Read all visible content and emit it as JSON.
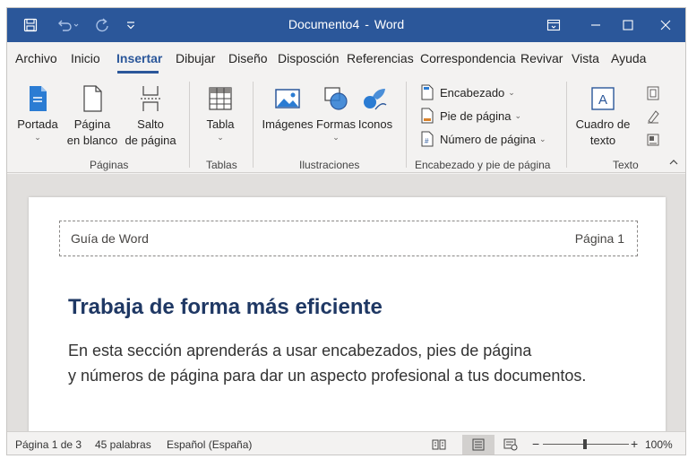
{
  "window": {
    "doc_name": "Documento4",
    "separator": "-",
    "app_name": "Word"
  },
  "menu": {
    "tabs": [
      "Archivo",
      "Inicio",
      "Insertar",
      "Dibujar",
      "Diseño",
      "Disposción",
      "Referencias",
      "Correspondencia",
      "Revivar",
      "Vista",
      "Ayuda"
    ],
    "active": "Insertar"
  },
  "ribbon": {
    "paginas": {
      "portada": "Portada",
      "pagina_line1": "Página",
      "pagina_line2": "en blanco",
      "salto_line1": "Salto",
      "salto_line2": "de página",
      "group": "Páginas"
    },
    "tablas": {
      "tabla": "Tabla",
      "group": "Tablas"
    },
    "ilustraciones": {
      "imagenes": "Imágenes",
      "formas": "Formas",
      "iconos": "Iconos",
      "group": "Ilustraciones"
    },
    "encabezado": {
      "encabezado": "Encabezado",
      "pie": "Pie de página",
      "numero": "Número de página",
      "group": "Encabezado y pie de página"
    },
    "texto": {
      "cuadro_line1": "Cuadro de",
      "cuadro_line2": "texto",
      "group": "Texto"
    }
  },
  "document": {
    "header_left": "Guía de Word",
    "header_right": "Página 1",
    "heading": "Trabaja de forma más eficiente",
    "body_line1": "En esta sección aprenderás a usar encabezados, pies de página",
    "body_line2": "y números de página para dar un aspecto profesional a tus documentos."
  },
  "status": {
    "page": "Página 1 de 3",
    "words": "45 palabras",
    "language": "Español (España)",
    "zoom_minus": "−",
    "zoom_plus": "+",
    "zoom": "100%",
    "zoom_level_percent": 100
  },
  "colors": {
    "accent": "#2b579a",
    "heading": "#1f3864"
  },
  "icons": [
    "save-icon",
    "undo-icon",
    "redo-icon",
    "customize-qat-icon",
    "ribbon-display-icon",
    "minimize-icon",
    "maximize-icon",
    "close-icon",
    "cover-page-icon",
    "blank-page-icon",
    "page-break-icon",
    "table-icon",
    "pictures-icon",
    "shapes-icon",
    "icons-icon",
    "header-icon",
    "footer-icon",
    "page-number-icon",
    "text-box-icon",
    "quick-parts-icon",
    "wordart-icon",
    "drop-cap-icon",
    "collapse-ribbon-icon",
    "read-mode-icon",
    "print-layout-icon",
    "web-layout-icon"
  ]
}
